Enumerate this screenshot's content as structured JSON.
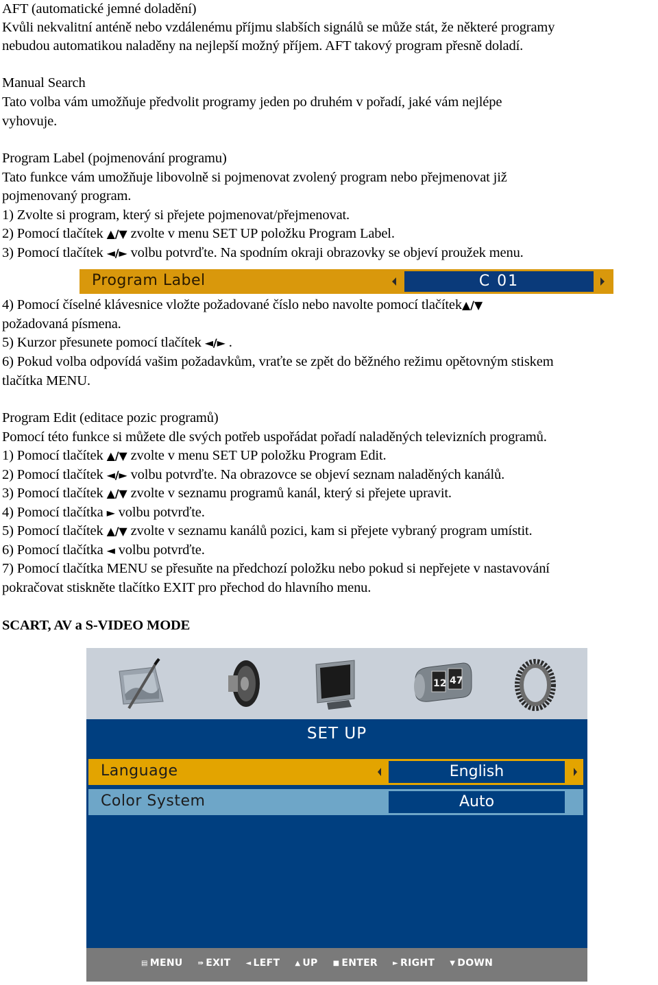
{
  "sections": {
    "aft": {
      "heading": "AFT (automatické jemné doladění)",
      "lines": [
        "Kvůli nekvalitní anténě nebo vzdálenému příjmu slabších signálů se může stát, že některé programy",
        "nebudou automatikou naladěny na nejlepší možný příjem. AFT takový program přesně doladí."
      ]
    },
    "manual_search": {
      "heading": "Manual Search",
      "lines": [
        "Tato volba vám umožňuje předvolit programy jeden po druhém v pořadí, jaké vám nejlépe",
        "vyhovuje."
      ]
    },
    "program_label": {
      "heading": "Program Label (pojmenování programu)",
      "lines": [
        "Tato funkce vám umožňuje libovolně si pojmenovat zvolený program nebo přejmenovat již",
        "pojmenovaný program.",
        "1) Zvolte si program, který si přejete pojmenovat/přejmenovat."
      ],
      "step2": {
        "pre": "2) Pomocí tlačítek ",
        "sym": "▲/▼",
        "post": " zvolte v menu SET UP položku Program Label."
      },
      "step3": {
        "pre": "3) Pomocí tlačítek ",
        "sym": "◄/►",
        "post": " volbu potvrďte. Na spodním okraji obrazovky se objeví proužek menu."
      },
      "bar": {
        "label": "Program Label",
        "value": "C 01"
      },
      "step4": {
        "pre": "4) Pomocí číselné klávesnice vložte požadované číslo nebo navolte pomocí tlačítek",
        "sym": "▲/▼",
        "cont": "požadovaná písmena."
      },
      "step5": {
        "pre": "5) Kurzor přesunete pomocí tlačítek ",
        "sym": "◄/►",
        "post": " ."
      },
      "step6": [
        "6) Pokud volba odpovídá vašim požadavkům, vraťte se zpět do běžného režimu opětovným stiskem",
        "tlačítka MENU."
      ]
    },
    "program_edit": {
      "heading": "Program Edit (editace pozic programů)",
      "intro": "Pomocí této funkce si můžete dle svých potřeb uspořádat pořadí naladěných televizních programů.",
      "steps": [
        {
          "pre": "1) Pomocí tlačítek ",
          "sym": "▲/▼",
          "post": " zvolte v menu SET UP položku Program Edit."
        },
        {
          "pre": "2) Pomocí tlačítek ",
          "sym": "◄/►",
          "post": " volbu potvrďte. Na obrazovce se objeví seznam naladěných kanálů."
        },
        {
          "pre": "3) Pomocí tlačítek ",
          "sym": "▲/▼",
          "post": " zvolte v seznamu programů kanál, který si přejete upravit."
        },
        {
          "pre": "4) Pomocí tlačítka ",
          "sym": "►",
          "post": " volbu potvrďte."
        },
        {
          "pre": "5) Pomocí tlačítek ",
          "sym": "▲/▼",
          "post": " zvolte v seznamu kanálů pozici, kam si přejete vybraný program umístit."
        },
        {
          "pre": "6) Pomocí tlačítka ",
          "sym": "◄",
          "post": " volbu potvrďte."
        }
      ],
      "step7": [
        "7) Pomocí tlačítka MENU se přesuňte na předchozí položku nebo pokud si nepřejete v nastavování",
        "pokračovat stiskněte tlačítko EXIT pro přechod do hlavního menu."
      ]
    },
    "scart": {
      "heading": "SCART, AV a S-VIDEO MODE"
    }
  },
  "tv_menu": {
    "icons": [
      "picture-icon",
      "sound-icon",
      "monitor-icon",
      "clock-icon",
      "gear-icon"
    ],
    "clock_digits": [
      "12",
      "47"
    ],
    "title": "SET UP",
    "rows": [
      {
        "label": "Language",
        "value": "English",
        "selected": true
      },
      {
        "label": "Color System",
        "value": "Auto",
        "selected": false
      }
    ],
    "footer": [
      {
        "icon": "▤",
        "label": "MENU"
      },
      {
        "icon": "⇛",
        "label": "EXIT"
      },
      {
        "icon": "◄",
        "label": "LEFT"
      },
      {
        "icon": "▲",
        "label": "UP"
      },
      {
        "icon": "■",
        "label": "ENTER"
      },
      {
        "icon": "►",
        "label": "RIGHT"
      },
      {
        "icon": "▼",
        "label": "DOWN"
      }
    ],
    "colors": {
      "icon_bar": "#c9d0d9",
      "menu_blue": "#003f80",
      "selected_row": "#e3a400",
      "normal_row": "#6ea6c8",
      "footer": "#7a7a7a"
    }
  }
}
